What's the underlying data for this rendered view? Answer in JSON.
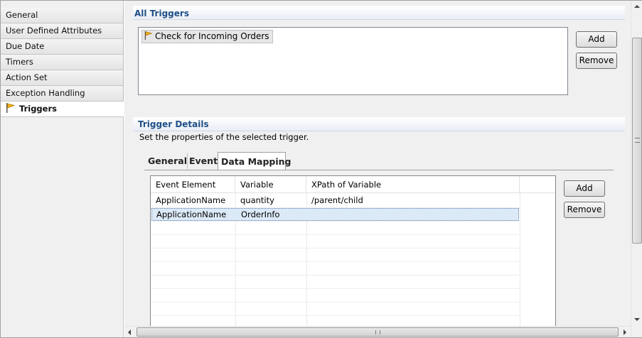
{
  "sidebar": {
    "items": [
      {
        "label": "General"
      },
      {
        "label": "User Defined Attributes"
      },
      {
        "label": "Due Date"
      },
      {
        "label": "Timers"
      },
      {
        "label": "Action Set"
      },
      {
        "label": "Exception Handling"
      },
      {
        "label": "Triggers",
        "icon": "flag-icon",
        "active": true
      }
    ]
  },
  "all_triggers": {
    "title": "All Triggers",
    "items": [
      {
        "label": "Check for Incoming Orders",
        "icon": "flag-icon"
      }
    ],
    "add_label": "Add",
    "remove_label": "Remove"
  },
  "trigger_details": {
    "title": "Trigger Details",
    "description": "Set the properties of the selected trigger.",
    "tabs": [
      {
        "label": "General"
      },
      {
        "label": "Event"
      },
      {
        "label": "Data Mapping",
        "active": true
      }
    ],
    "table": {
      "columns": [
        "Event Element",
        "Variable",
        "XPath of Variable"
      ],
      "rows": [
        [
          "ApplicationName",
          "quantity",
          "/parent/child"
        ],
        [
          "ApplicationName",
          "OrderInfo",
          ""
        ]
      ],
      "selected_row": 1
    },
    "add_label": "Add",
    "remove_label": "Remove"
  },
  "colors": {
    "section_title": "#1f4f87",
    "selection": "#dce9f7",
    "flag": "#e8a400"
  }
}
